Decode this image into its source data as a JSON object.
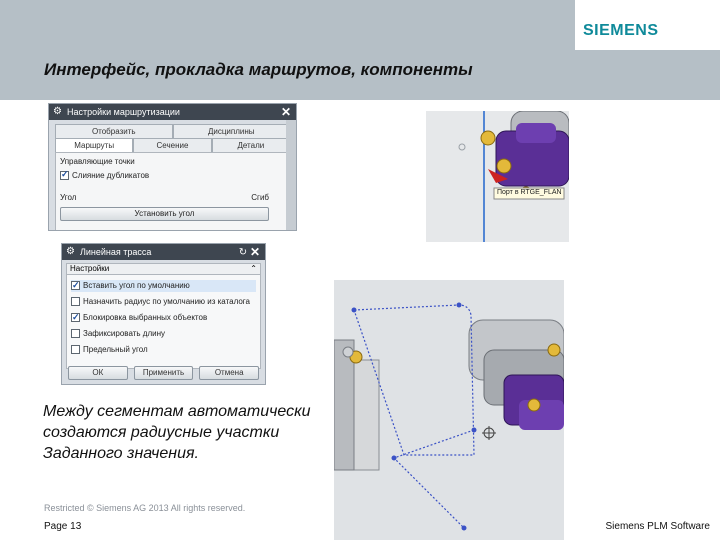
{
  "header": {
    "title": "Интерфейс, прокладка маршрутов, компоненты",
    "logo": "SIEMENS",
    "accent_color": "#0f8a9a",
    "band_color": "#b5bfc6"
  },
  "dialog_routing": {
    "title": "Настройки маршрутизации",
    "tabs_row1": [
      "Отобразить",
      "Дисциплины"
    ],
    "tabs_row2": [
      "Маршруты",
      "Сечение",
      "Детали"
    ],
    "group_label": "Управляющие точки",
    "merge_duplicates_label": "Слияние дубликатов",
    "merge_duplicates_checked": true,
    "angle_label": "Угол",
    "bend_label": "Сгиб",
    "set_angle_button": "Установить угол"
  },
  "dialog_linear": {
    "title": "Линейная трасса",
    "section": "Настройки",
    "options": [
      {
        "label": "Вставить угол по умолчанию",
        "checked": true
      },
      {
        "label": "Назначить радиус по умолчанию из каталога",
        "checked": false
      },
      {
        "label": "Блокировка выбранных объектов",
        "checked": true
      },
      {
        "label": "Зафиксировать длину",
        "checked": false
      },
      {
        "label": "Предельный угол",
        "checked": false
      }
    ],
    "buttons": [
      "ОК",
      "Применить",
      "Отмена"
    ]
  },
  "view1": {
    "tooltip": "Порт в RTGE_FLAN"
  },
  "body_text": [
    "Между сегментам автоматически",
    "создаются радиусные участки",
    "Заданного значения."
  ],
  "footer": {
    "copyright": "Restricted © Siemens AG 2013 All rights reserved.",
    "page": "Page 13",
    "company": "Siemens PLM Software"
  }
}
